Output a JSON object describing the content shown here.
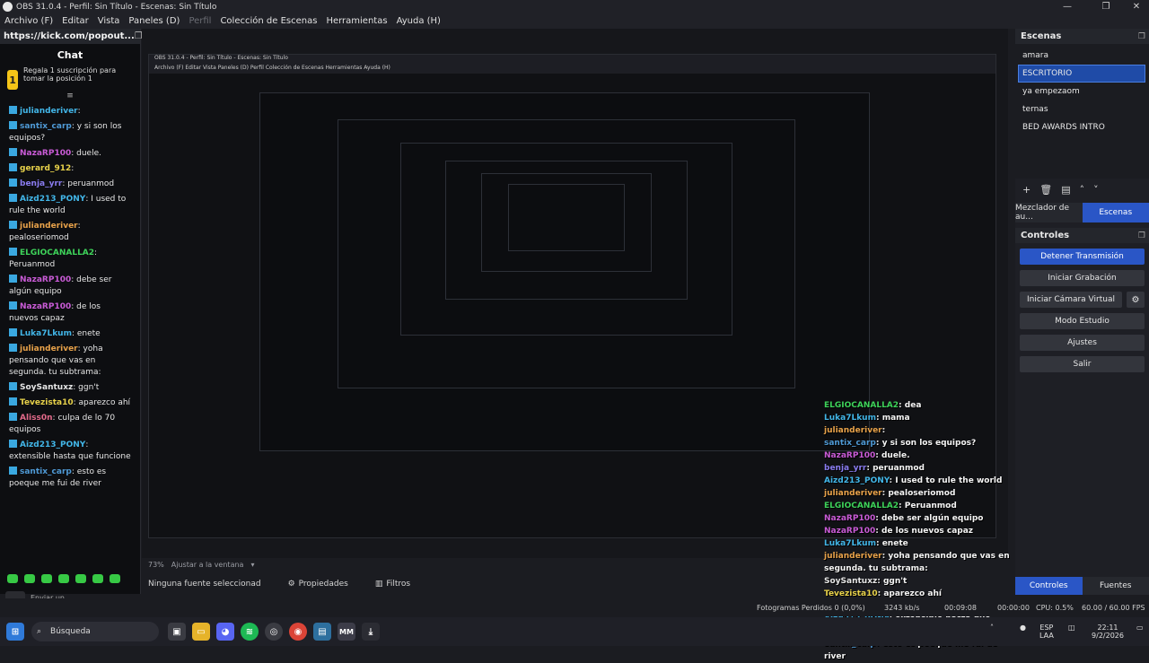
{
  "window": {
    "title": "OBS 31.0.4 - Perfil: Sin Título - Escenas: Sin Título",
    "controls": [
      "—",
      "❐",
      "✕"
    ]
  },
  "menu": [
    "Archivo (F)",
    "Editar",
    "Vista",
    "Paneles (D)",
    "Perfil",
    "Colección de Escenas",
    "Herramientas",
    "Ayuda (H)"
  ],
  "chat_dock": {
    "url": "https://kick.com/popout...",
    "title": "Chat",
    "gift_badge": "1",
    "gift_text": "Regala 1 suscripción para tomar la posición 1",
    "messages": [
      {
        "user": "julianderiver",
        "text": "",
        "color": "#42b6e8"
      },
      {
        "user": "santix_carp",
        "text": "y si son los equipos?",
        "color": "#4f9ad6"
      },
      {
        "user": "NazaRP100",
        "text": "duele.",
        "color": "#c95bd6"
      },
      {
        "user": "gerard_912",
        "text": "",
        "color": "#e8d24a"
      },
      {
        "user": "benja_yrr",
        "text": "peruanmod",
        "color": "#8a7cf0"
      },
      {
        "user": "Aizd213_PONY",
        "text": "I used to rule the world",
        "color": "#42b6e8"
      },
      {
        "user": "julianderiver",
        "text": "pealoseriomod",
        "color": "#e8a24a"
      },
      {
        "user": "ELGIOCANALLA2",
        "text": "Peruanmod",
        "color": "#3ed35a"
      },
      {
        "user": "NazaRP100",
        "text": "debe ser algún equipo",
        "color": "#c95bd6"
      },
      {
        "user": "NazaRP100",
        "text": "de los nuevos capaz",
        "color": "#c95bd6"
      },
      {
        "user": "Luka7Lkum",
        "text": "enete",
        "color": "#42b6e8"
      },
      {
        "user": "julianderiver",
        "text": "yoha pensando que vas en segunda. tu subtrama:",
        "color": "#e8a24a"
      },
      {
        "user": "SoySantuxz",
        "text": "ggn't",
        "color": "#e6e6e6"
      },
      {
        "user": "Tevezista10",
        "text": "aparezco ahí",
        "color": "#e8d24a"
      },
      {
        "user": "Aliss0n",
        "text": "culpa de lo 70 equipos",
        "color": "#e26a8a"
      },
      {
        "user": "Aizd213_PONY",
        "text": "extensible hasta que funcione",
        "color": "#42b6e8"
      },
      {
        "user": "santix_carp",
        "text": "esto es poeque me fui de river",
        "color": "#4f9ad6"
      }
    ],
    "send_placeholder": "Enviar un mensaje"
  },
  "preview": {
    "overlay_messages": [
      {
        "user": "ELGIOCANALLA2",
        "text": "dea",
        "color": "#3ed35a"
      },
      {
        "user": "Luka7Lkum",
        "text": "mama",
        "color": "#42b6e8"
      },
      {
        "user": "julianderiver",
        "text": "",
        "color": "#e8a24a"
      },
      {
        "user": "santix_carp",
        "text": "y si son los equipos?",
        "color": "#4f9ad6"
      },
      {
        "user": "NazaRP100",
        "text": "duele.",
        "color": "#c95bd6"
      },
      {
        "user": "benja_yrr",
        "text": "peruanmod",
        "color": "#8a7cf0"
      },
      {
        "user": "Aizd213_PONY",
        "text": "I used to rule the world",
        "color": "#42b6e8"
      },
      {
        "user": "julianderiver",
        "text": "pealoseriomod",
        "color": "#e8a24a"
      },
      {
        "user": "ELGIOCANALLA2",
        "text": "Peruanmod",
        "color": "#3ed35a"
      },
      {
        "user": "NazaRP100",
        "text": "debe ser algún equipo",
        "color": "#c95bd6"
      },
      {
        "user": "NazaRP100",
        "text": "de los nuevos capaz",
        "color": "#c95bd6"
      },
      {
        "user": "Luka7Lkum",
        "text": "enete",
        "color": "#42b6e8"
      },
      {
        "user": "julianderiver",
        "text": "yoha pensando que vas en segunda. tu subtrama:",
        "color": "#e8a24a"
      },
      {
        "user": "SoySantuxz",
        "text": "ggn't",
        "color": "#e6e6e6"
      },
      {
        "user": "Tevezista10",
        "text": "aparezco ahí",
        "color": "#e8d24a"
      },
      {
        "user": "Aliss0n",
        "text": "culpa de lo 70 equipos",
        "color": "#e26a8a"
      },
      {
        "user": "Aizd213_PONY",
        "text": "extensible hasta que funcione",
        "color": "#42b6e8"
      },
      {
        "user": "santix_carp",
        "text": "esto es poeque me fui de river",
        "color": "#4f9ad6"
      }
    ]
  },
  "scenes_dock": {
    "title": "Escenas",
    "scenes": [
      "amara",
      "ESCRITORIO",
      "ya empezaom",
      "ternas",
      "BED AWARDS INTRO"
    ],
    "selected": "ESCRITORIO",
    "tabs": [
      "Mezclador de au...",
      "Escenas"
    ],
    "active_tab": "Escenas"
  },
  "controls_dock": {
    "title": "Controles",
    "stop_stream": "Detener Transmisión",
    "start_recording": "Iniciar Grabación",
    "virtual_cam": "Iniciar Cámara Virtual",
    "studio_mode": "Modo Estudio",
    "settings": "Ajustes",
    "exit": "Salir",
    "tabs": [
      "Controles",
      "Fuentes"
    ],
    "active_tab": "Controles"
  },
  "zoom": {
    "value": "73%",
    "label": "Ajustar a la ventana"
  },
  "source_bar": {
    "no_source": "Ninguna fuente seleccionad",
    "properties": "Propiedades",
    "filters": "Filtros"
  },
  "status": {
    "dropped_frames": "Fotogramas Perdidos 0 (0,0%)",
    "data": "3243 kb/s",
    "live_time": "00:09:08",
    "rec_time": "00:00:00",
    "cpu": "CPU: 0.5%",
    "fps": "60.00 / 60.00 FPS"
  },
  "taskbar": {
    "search_placeholder": "Búsqueda",
    "lang": "ESP",
    "lang2": "LAA",
    "time": "22:11",
    "date": "9/2/2026"
  }
}
